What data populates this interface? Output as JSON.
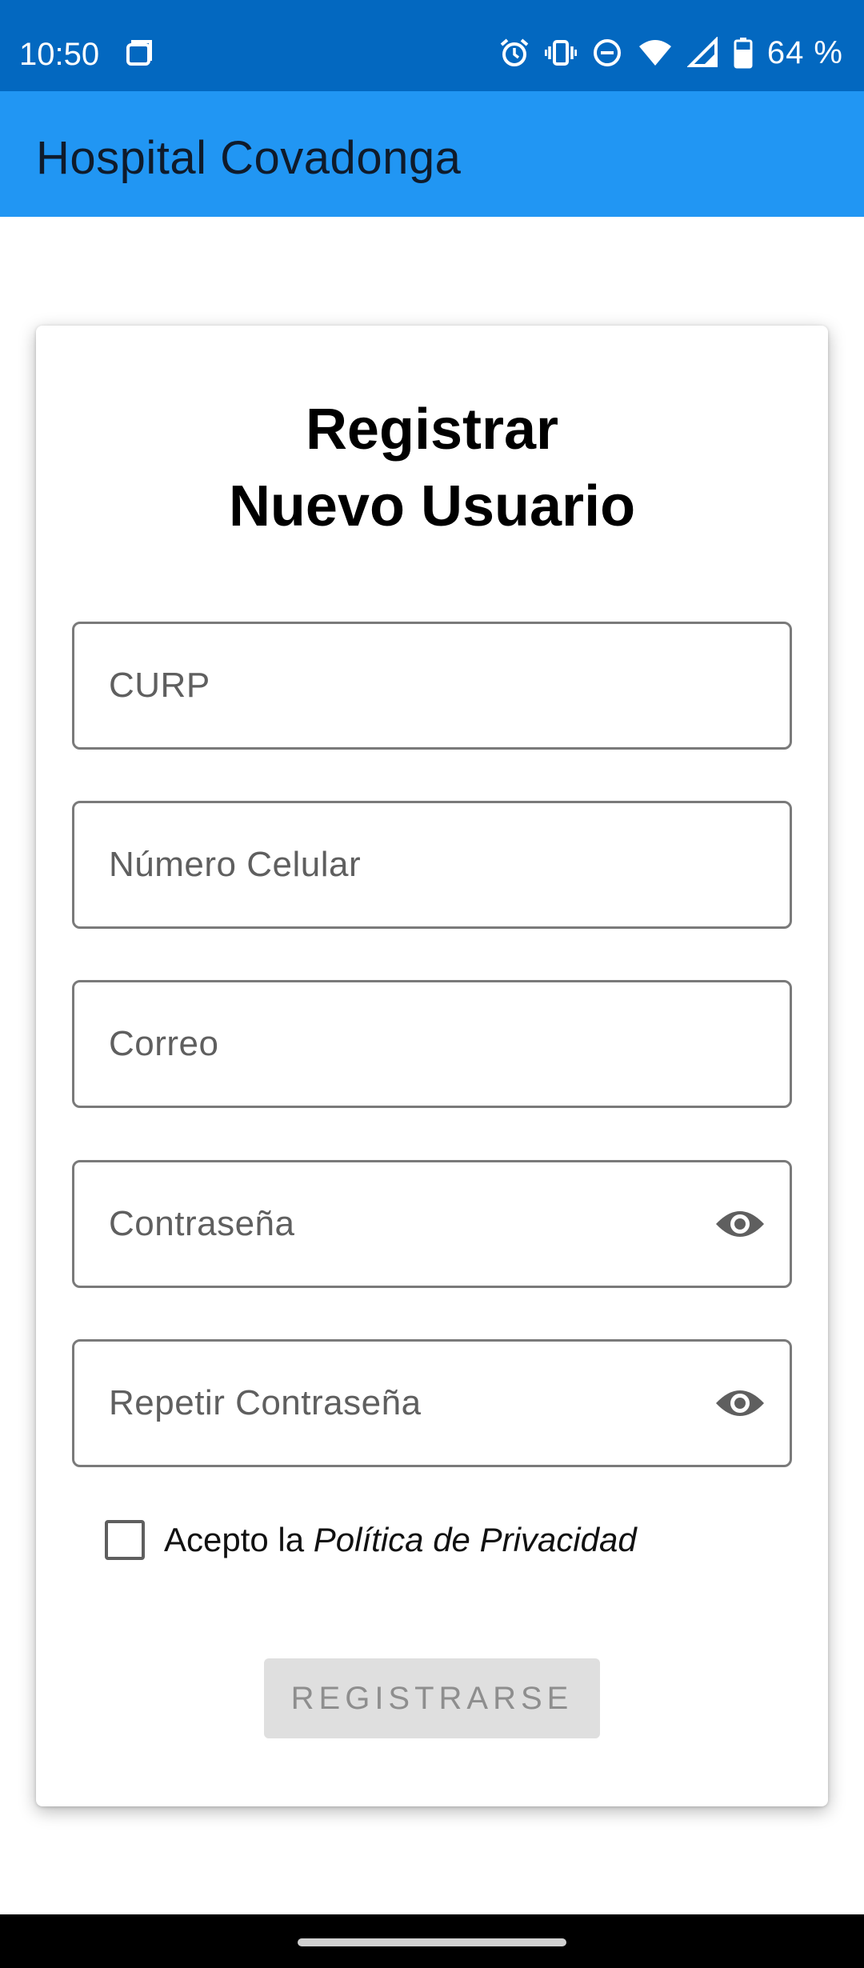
{
  "status_bar": {
    "time": "10:50",
    "battery_percent": "64 %",
    "icons": [
      "screen-record-icon",
      "alarm-icon",
      "vibrate-icon",
      "do-not-disturb-icon",
      "wifi-icon",
      "signal-icon",
      "battery-icon"
    ]
  },
  "app_bar": {
    "title": "Hospital Covadonga",
    "color": "#2196f3"
  },
  "form": {
    "title_line1": "Registrar",
    "title_line2": "Nuevo Usuario",
    "fields": {
      "curp": {
        "label": "CURP"
      },
      "phone": {
        "label": "Número Celular"
      },
      "email": {
        "label": "Correo"
      },
      "password": {
        "label": "Contraseña",
        "icon": "eye-icon"
      },
      "repeat_password": {
        "label": "Repetir Contraseña",
        "icon": "eye-icon"
      }
    },
    "privacy": {
      "prefix": "Acepto la ",
      "link": "Política de Privacidad",
      "checked": false
    },
    "submit_label": "REGISTRARSE",
    "submit_enabled": false
  },
  "colors": {
    "status_bar": "#0368c0",
    "app_bar": "#2196f3",
    "button_disabled": "#dfdfdf"
  }
}
